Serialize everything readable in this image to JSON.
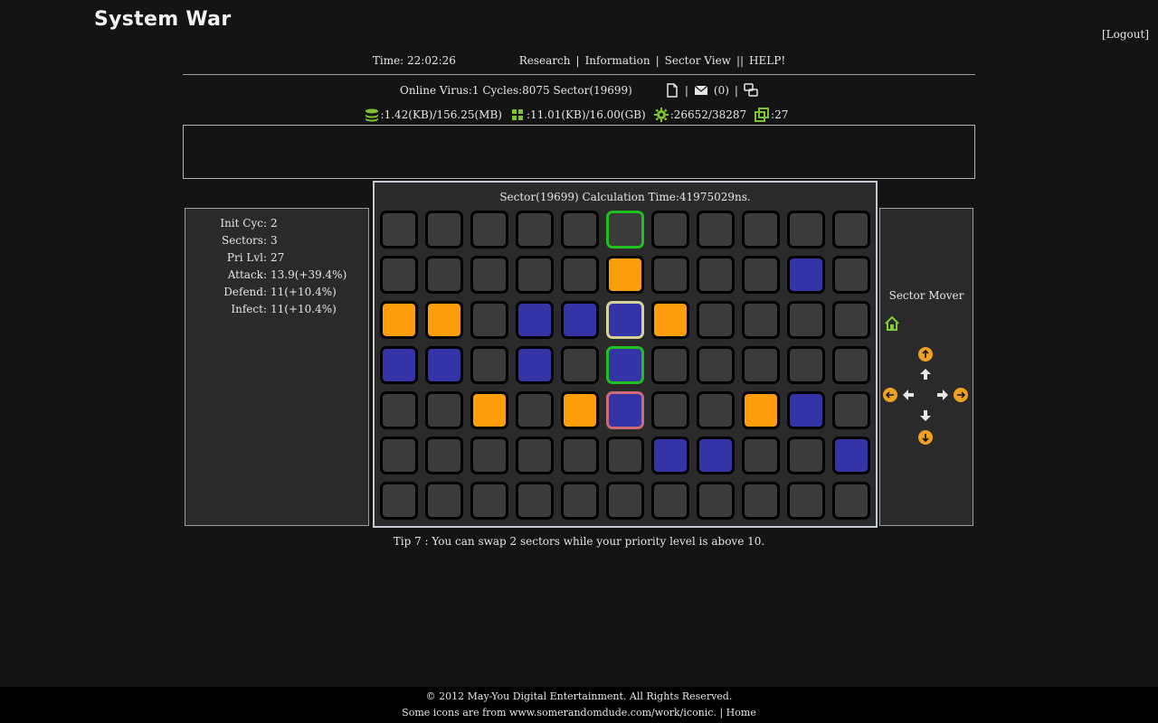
{
  "header": {
    "logo": "System War",
    "logout": "[Logout]"
  },
  "nav": {
    "time": "Time: 22:02:26",
    "links": [
      "Research",
      "Information",
      "Sector View",
      "HELP!"
    ],
    "sep1": "|",
    "sep2": "|",
    "sep3": "||"
  },
  "status": {
    "online": "Online Virus:1 Cycles:8075 Sector(19699)",
    "sep": "|",
    "mail": "(0)",
    "memory": ":1.42(KB)/156.25(MB)",
    "storage": ":11.01(KB)/16.00(GB)",
    "cpu": ":26652/38287",
    "instances": ":27"
  },
  "stats": [
    {
      "label": "Init Cyc:",
      "value": "2"
    },
    {
      "label": "Sectors:",
      "value": "3"
    },
    {
      "label": "Pri Lvl:",
      "value": "27"
    },
    {
      "label": "Attack:",
      "value": "13.9(+39.4%)"
    },
    {
      "label": "Defend:",
      "value": "11(+10.4%)"
    },
    {
      "label": "Infect:",
      "value": "11(+10.4%)"
    }
  ],
  "board": {
    "title": "Sector(19699) Calculation Time:41975029ns.",
    "rows": [
      [
        "gray",
        "gray",
        "gray",
        "gray",
        "gray",
        "gray",
        "gray",
        "gray",
        "gray",
        "gray",
        "gray"
      ],
      [
        "gray",
        "gray",
        "gray",
        "gray",
        "gray",
        "orange",
        "gray",
        "gray",
        "gray",
        "blue",
        "gray"
      ],
      [
        "orange",
        "orange",
        "gray",
        "blue",
        "blue",
        "blue",
        "orange",
        "gray",
        "gray",
        "gray",
        "gray"
      ],
      [
        "blue",
        "blue",
        "gray",
        "blue",
        "gray",
        "blue",
        "gray",
        "gray",
        "gray",
        "gray",
        "gray"
      ],
      [
        "gray",
        "gray",
        "orange",
        "gray",
        "orange",
        "blue",
        "gray",
        "gray",
        "orange",
        "blue",
        "gray"
      ],
      [
        "gray",
        "gray",
        "gray",
        "gray",
        "gray",
        "gray",
        "blue",
        "blue",
        "gray",
        "gray",
        "blue"
      ],
      [
        "gray",
        "gray",
        "gray",
        "gray",
        "gray",
        "gray",
        "gray",
        "gray",
        "gray",
        "gray",
        "gray"
      ]
    ],
    "highlights": [
      {
        "row": 0,
        "col": 5,
        "style": "green"
      },
      {
        "row": 2,
        "col": 5,
        "style": "yellow"
      },
      {
        "row": 3,
        "col": 5,
        "style": "green"
      },
      {
        "row": 4,
        "col": 5,
        "style": "red"
      }
    ]
  },
  "mover": {
    "title": "Sector Mover",
    "home_icon": "home-icon",
    "arrow_color": "#e8e8e8",
    "badge_color": "#f0a020",
    "house_color": "#7ecb3b"
  },
  "tip": "Tip 7 : You can swap 2 sectors while your priority level is above 10.",
  "footer": {
    "line1": "© 2012 May-You Digital Entertainment. All Rights Reserved.",
    "line2": "Some icons are from www.somerandomdude.com/work/iconic.",
    "sep": "|",
    "home": "Home"
  },
  "colors": {
    "orange": "#ff9e0d",
    "blue": "#3434a6",
    "cell_gray": "#3b3b3b",
    "highlight_green": "#1fc01f",
    "highlight_yellow": "#d6d09a",
    "highlight_red": "#cc6a78",
    "icon_green": "#7fc22f"
  }
}
